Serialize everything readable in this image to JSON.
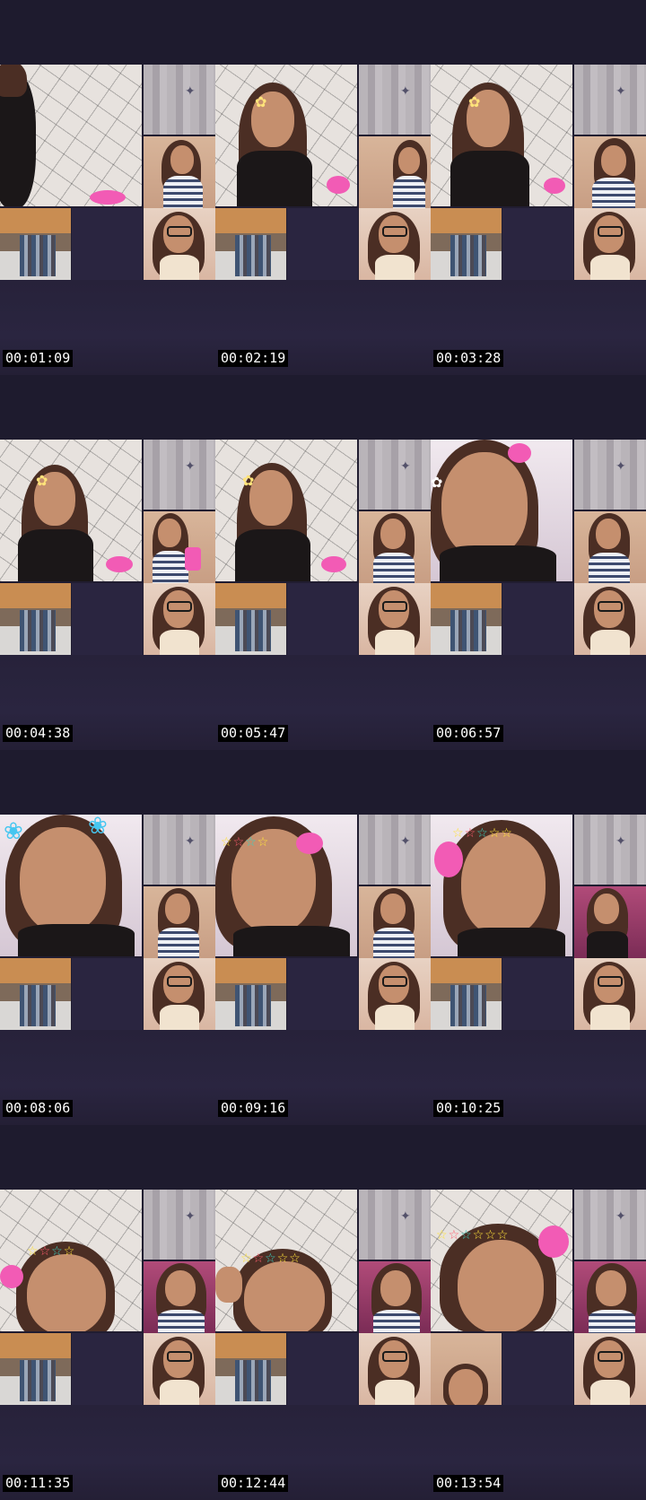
{
  "timestamps": [
    "00:01:09",
    "00:02:19",
    "00:03:28",
    "00:04:38",
    "00:05:47",
    "00:06:57",
    "00:08:06",
    "00:09:16",
    "00:10:25",
    "00:11:35",
    "00:12:44",
    "00:13:54"
  ],
  "colors": {
    "background": "#1e1b2c",
    "timestamp_bg": "#000000",
    "timestamp_text": "#ffffff"
  },
  "icons": [
    "flower-filter-icon",
    "star-crown-filter-icon",
    "butterfly-bow-filter-icon"
  ]
}
